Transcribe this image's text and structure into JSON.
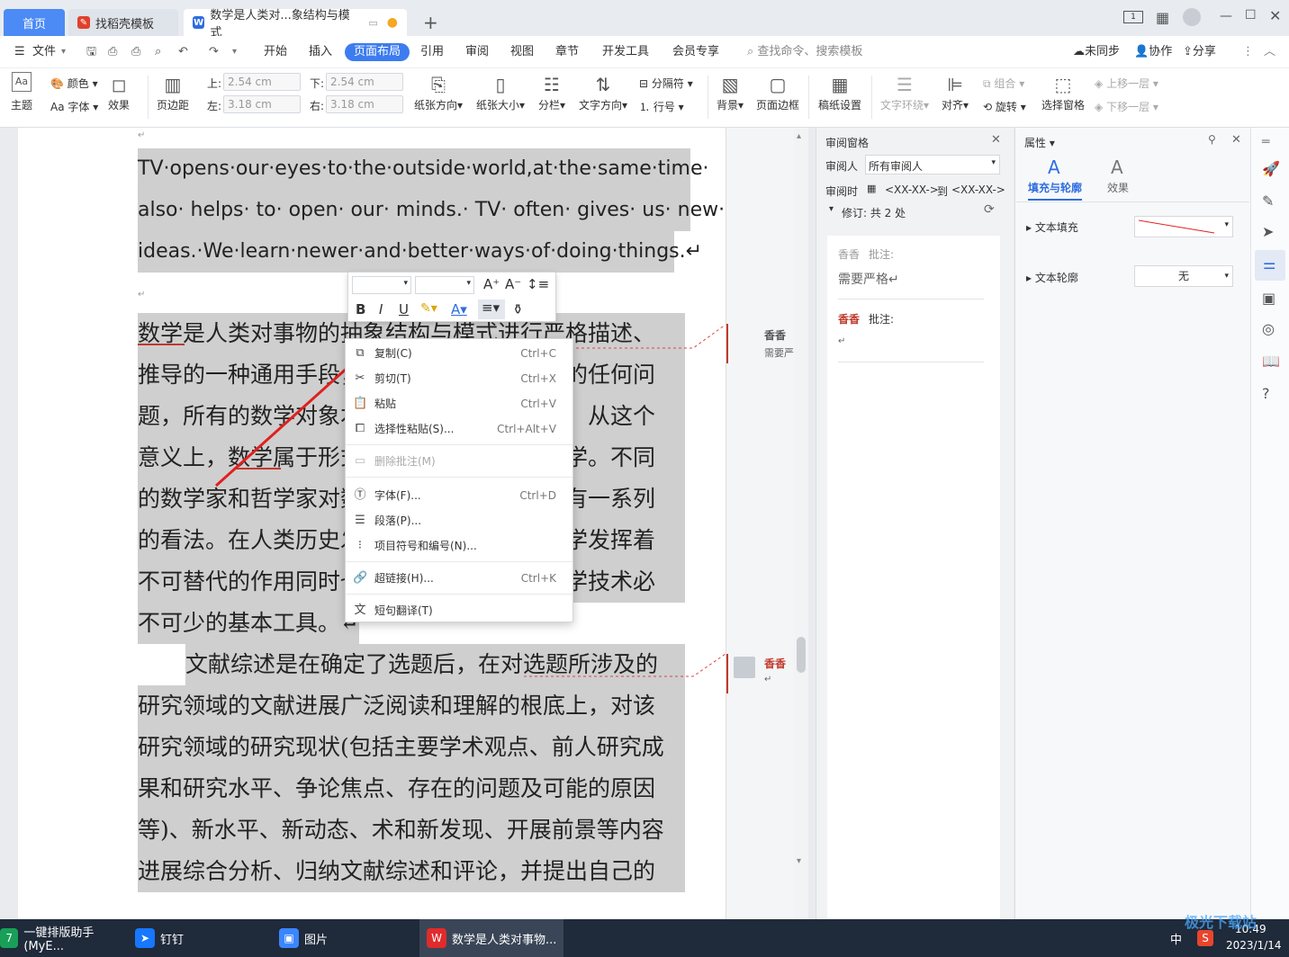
{
  "tabs": {
    "home": "首页",
    "template": "找稻壳模板",
    "doc": "数学是人类对...象结构与模式",
    "add": "+"
  },
  "menu": {
    "file": "文件",
    "items": [
      "开始",
      "插入",
      "页面布局",
      "引用",
      "审阅",
      "视图",
      "章节",
      "开发工具",
      "会员专享"
    ],
    "search_placeholder": "查找命令、搜索模板",
    "sync": "未同步",
    "collab": "协作",
    "share": "分享"
  },
  "ribbon": {
    "theme": "主题",
    "color": "颜色",
    "font": "Aa 字体",
    "effect": "效果",
    "margin": "页边距",
    "top_label": "上:",
    "top_val": "2.54 cm",
    "bottom_label": "下:",
    "bottom_val": "2.54 cm",
    "left_label": "左:",
    "left_val": "3.18 cm",
    "right_label": "右:",
    "right_val": "3.18 cm",
    "orientation": "纸张方向",
    "size": "纸张大小",
    "columns": "分栏",
    "direction": "文字方向",
    "breaks": "分隔符",
    "line_no": "行号",
    "background": "背景",
    "border": "页面边框",
    "manuscript": "稿纸设置",
    "wrap": "文字环绕",
    "align": "对齐",
    "group": "组合",
    "rotate": "旋转",
    "select_pane": "选择窗格",
    "bring_up": "上移一层",
    "send_down": "下移一层"
  },
  "document": {
    "en_lines": [
      "TV·opens·our·eyes·to·the·outside·world,at·the·same·time·",
      "also· helps· to· open· our· minds.· TV· often· gives· us· new·",
      "ideas.·We·learn·newer·and·better·ways·of·doing·things.↵"
    ],
    "cn_lines": [
      "数学是人类对事物的抽象结构与模式进行严格描述、",
      "推导的一种通用手段，可以应用于现实世界的任何问",
      "题，所有的数学对象本质上都是人为定义的。从这个",
      "意义上，数学属于形式科学，而不是自然科学。不同",
      "的数学家和哲学家对数学的确切范围和定义有一系列",
      "的看法。在人类历史发展和社会生活中，数学发挥着",
      "不可替代的作用同时也是学习和研究现代科学技术必",
      "不可少的基本工具。↵"
    ],
    "p3_lines": [
      "文献综述是在确定了选题后，在对选题所涉及的",
      "研究领域的文献进展广泛阅读和理解的根底上，对该",
      "研究领域的研究现状(包括主要学术观点、前人研究成",
      "果和研究水平、争论焦点、存在的问题及可能的原因",
      "等)、新水平、新动态、术和新发现、开展前景等内容",
      "进展综合分析、归纳文献综述和评论，并提出自己的"
    ]
  },
  "comments_rail": {
    "c1_author": "香香",
    "c1_text": "需要严",
    "c2_author": "香香",
    "c2_mark": "↵"
  },
  "review_pane": {
    "title": "审阅窗格",
    "reviewer_label": "审阅人",
    "reviewer_value": "所有审阅人",
    "time_label": "审阅时",
    "time_from": "<XX-XX->",
    "time_to_word": "到",
    "time_to": "<XX-XX->",
    "revisions": "修订:  共 2 处",
    "c1_author": "香香",
    "c1_type": "批注:",
    "c1_text": "需要严格↵",
    "c2_author": "香香",
    "c2_type": "批注:",
    "c2_text": "↵"
  },
  "properties": {
    "title": "属性",
    "tab_fill": "填充与轮廓",
    "tab_effect": "效果",
    "text_fill": "文本填充",
    "text_outline": "文本轮廓",
    "outline_value": "无"
  },
  "context_menu": {
    "items": [
      {
        "label": "复制(C)",
        "key": "Ctrl+C"
      },
      {
        "label": "剪切(T)",
        "key": "Ctrl+X"
      },
      {
        "label": "粘贴",
        "key": "Ctrl+V"
      },
      {
        "label": "选择性粘贴(S)...",
        "key": "Ctrl+Alt+V"
      },
      {
        "label": "删除批注(M)",
        "key": ""
      },
      {
        "label": "字体(F)...",
        "key": "Ctrl+D"
      },
      {
        "label": "段落(P)...",
        "key": ""
      },
      {
        "label": "项目符号和编号(N)...",
        "key": ""
      },
      {
        "label": "超链接(H)...",
        "key": "Ctrl+K"
      },
      {
        "label": "短句翻译(T)",
        "key": ""
      }
    ]
  },
  "taskbar": {
    "app1": "一键排版助手(MyE...",
    "app2": "钉钉",
    "app3": "图片",
    "app4": "数学是人类对事物...",
    "ime": "中",
    "time": "10:49",
    "date": "2023/1/14",
    "watermark": "极光下载站"
  }
}
